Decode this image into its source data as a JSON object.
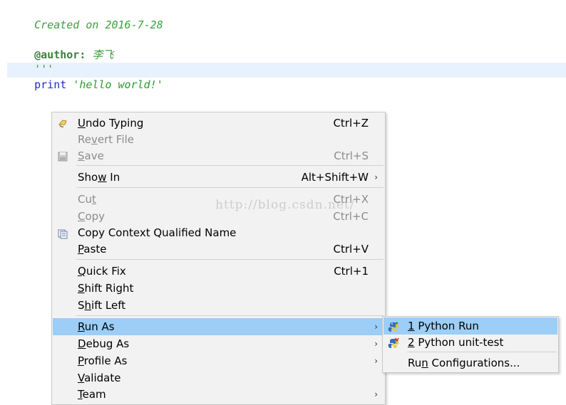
{
  "editor": {
    "lines": [
      {
        "text": "Created on 2016-7-28"
      },
      {
        "key": "@author:",
        "value": " 李飞"
      },
      {
        "text": "'''"
      },
      {
        "kw": "print",
        "str": "'hello world!'"
      }
    ]
  },
  "context_menu": {
    "items": [
      {
        "label_pre": "",
        "label_u": "U",
        "label_post": "ndo Typing",
        "shortcut": "Ctrl+Z",
        "icon": "undo-icon",
        "disabled": false
      },
      {
        "label_pre": "Re",
        "label_u": "v",
        "label_post": "ert File",
        "shortcut": "",
        "icon": "",
        "disabled": true
      },
      {
        "label_pre": "",
        "label_u": "S",
        "label_post": "ave",
        "shortcut": "Ctrl+S",
        "icon": "save-icon",
        "disabled": true
      },
      {
        "label_pre": "Sho",
        "label_u": "w",
        "label_post": " In",
        "shortcut": "Alt+Shift+W",
        "icon": "",
        "disabled": false,
        "submenu": true
      },
      {
        "label_pre": "Cu",
        "label_u": "t",
        "label_post": "",
        "shortcut": "Ctrl+X",
        "icon": "",
        "disabled": true
      },
      {
        "label_pre": "",
        "label_u": "C",
        "label_post": "opy",
        "shortcut": "Ctrl+C",
        "icon": "",
        "disabled": true
      },
      {
        "label_pre": "",
        "label_u": "",
        "label_post": "Copy Context Qualified Name",
        "shortcut": "",
        "icon": "copy-qualified-name-icon",
        "disabled": false
      },
      {
        "label_pre": "",
        "label_u": "P",
        "label_post": "aste",
        "shortcut": "Ctrl+V",
        "icon": "",
        "disabled": false
      },
      {
        "label_pre": "",
        "label_u": "Q",
        "label_post": "uick Fix",
        "shortcut": "Ctrl+1",
        "icon": "",
        "disabled": false
      },
      {
        "label_pre": "",
        "label_u": "S",
        "label_post": "hift Right",
        "shortcut": "",
        "icon": "",
        "disabled": false
      },
      {
        "label_pre": "S",
        "label_u": "h",
        "label_post": "ift Left",
        "shortcut": "",
        "icon": "",
        "disabled": false
      },
      {
        "label_pre": "",
        "label_u": "R",
        "label_post": "un As",
        "shortcut": "",
        "icon": "",
        "disabled": false,
        "submenu": true,
        "highlight": true
      },
      {
        "label_pre": "",
        "label_u": "D",
        "label_post": "ebug As",
        "shortcut": "",
        "icon": "",
        "disabled": false,
        "submenu": true
      },
      {
        "label_pre": "",
        "label_u": "P",
        "label_post": "rofile As",
        "shortcut": "",
        "icon": "",
        "disabled": false,
        "submenu": true
      },
      {
        "label_pre": "",
        "label_u": "V",
        "label_post": "alidate",
        "shortcut": "",
        "icon": "",
        "disabled": false
      },
      {
        "label_pre": "",
        "label_u": "T",
        "label_post": "eam",
        "shortcut": "",
        "icon": "",
        "disabled": false,
        "submenu": true
      }
    ]
  },
  "run_as_submenu": {
    "items": [
      {
        "label_u": "1",
        "label_post": " Python Run",
        "icon": "python-run-icon",
        "highlight": true
      },
      {
        "label_u": "2",
        "label_post": " Python unit-test",
        "icon": "python-unittest-icon",
        "highlight": false
      },
      {
        "label_pre": "Ru",
        "label_u": "n",
        "label_post": " Configurations...",
        "icon": ""
      }
    ]
  },
  "watermark": "http://blog.csdn.net/",
  "colors": {
    "highlight": "#9ccef8",
    "menu_bg": "#f2f2f2",
    "doc_comment": "#3f9f3f",
    "keyword": "#1f2bd0",
    "string": "#2a9d2a"
  }
}
